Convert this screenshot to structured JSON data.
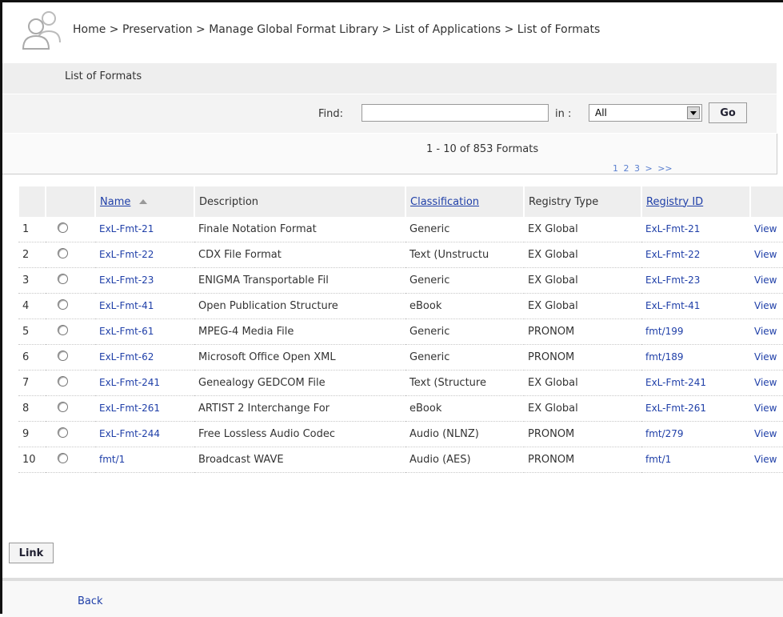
{
  "header": {
    "breadcrumb": "Home > Preservation > Manage Global Format Library > List of Applications > List of Formats"
  },
  "page_title": "List of Formats",
  "search": {
    "find_label": "Find:",
    "find_value": "",
    "in_label": "in :",
    "in_selected": "All",
    "go_label": "Go"
  },
  "results": {
    "count_text": "1 - 10 of 853 Formats",
    "pages": [
      "1",
      "2",
      "3",
      ">",
      ">>"
    ]
  },
  "table": {
    "columns": [
      "",
      "",
      "Name",
      "Description",
      "Classification",
      "Registry Type",
      "Registry ID",
      ""
    ],
    "rows": [
      {
        "num": "1",
        "name": "ExL-Fmt-21",
        "description": "Finale Notation Format",
        "classification": "Generic",
        "registry_type": "EX Global",
        "registry_id": "ExL-Fmt-21",
        "action": "View"
      },
      {
        "num": "2",
        "name": "ExL-Fmt-22",
        "description": "CDX File Format",
        "classification": "Text (Unstructu",
        "registry_type": "EX Global",
        "registry_id": "ExL-Fmt-22",
        "action": "View"
      },
      {
        "num": "3",
        "name": "ExL-Fmt-23",
        "description": "ENIGMA Transportable Fil",
        "classification": "Generic",
        "registry_type": "EX Global",
        "registry_id": "ExL-Fmt-23",
        "action": "View"
      },
      {
        "num": "4",
        "name": "ExL-Fmt-41",
        "description": "Open Publication Structure",
        "classification": "eBook",
        "registry_type": "EX Global",
        "registry_id": "ExL-Fmt-41",
        "action": "View"
      },
      {
        "num": "5",
        "name": "ExL-Fmt-61",
        "description": "MPEG-4 Media File",
        "classification": "Generic",
        "registry_type": "PRONOM",
        "registry_id": "fmt/199",
        "action": "View"
      },
      {
        "num": "6",
        "name": "ExL-Fmt-62",
        "description": "Microsoft Office Open XML",
        "classification": "Generic",
        "registry_type": "PRONOM",
        "registry_id": "fmt/189",
        "action": "View"
      },
      {
        "num": "7",
        "name": "ExL-Fmt-241",
        "description": "Genealogy GEDCOM File",
        "classification": "Text (Structure",
        "registry_type": "EX Global",
        "registry_id": "ExL-Fmt-241",
        "action": "View"
      },
      {
        "num": "8",
        "name": "ExL-Fmt-261",
        "description": "ARTIST 2 Interchange For",
        "classification": "eBook",
        "registry_type": "EX Global",
        "registry_id": "ExL-Fmt-261",
        "action": "View"
      },
      {
        "num": "9",
        "name": "ExL-Fmt-244",
        "description": "Free Lossless Audio Codec",
        "classification": "Audio (NLNZ)",
        "registry_type": "PRONOM",
        "registry_id": "fmt/279",
        "action": "View"
      },
      {
        "num": "10",
        "name": "fmt/1",
        "description": "Broadcast WAVE",
        "classification": "Audio (AES)",
        "registry_type": "PRONOM",
        "registry_id": "fmt/1",
        "action": "View"
      }
    ]
  },
  "actions": {
    "link_label": "Link",
    "back_label": "Back"
  },
  "colors": {
    "link": "#1f3fa8",
    "band": "#eeeeee"
  }
}
